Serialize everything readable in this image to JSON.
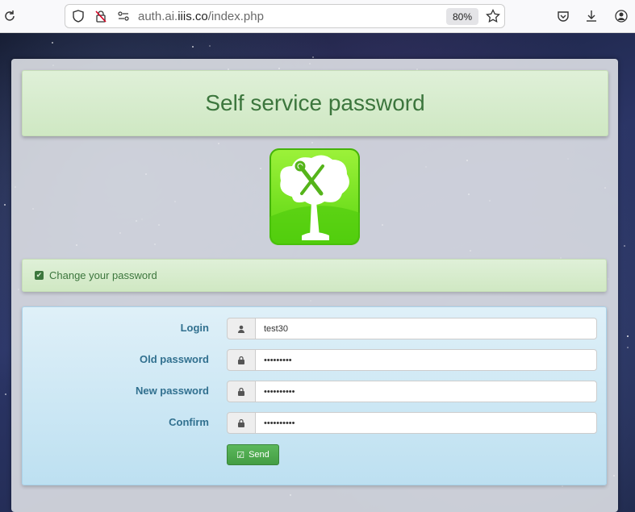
{
  "browser": {
    "url_domain": "auth.ai.",
    "url_highlight": "iiis.co",
    "url_path": "/index.php",
    "zoom": "80%"
  },
  "page": {
    "title": "Self service password",
    "alert_text": "Change your password",
    "form": {
      "fields": [
        {
          "label": "Login",
          "value": "test30",
          "icon": "user-icon"
        },
        {
          "label": "Old password",
          "value": "•••••••••",
          "icon": "lock-icon"
        },
        {
          "label": "New password",
          "value": "••••••••••",
          "icon": "lock-icon"
        },
        {
          "label": "Confirm",
          "value": "••••••••••",
          "icon": "lock-icon"
        }
      ],
      "send_label": "Send"
    }
  },
  "colors": {
    "success_text": "#3c763d",
    "info_text": "#31708f",
    "button_green": "#5cb85c"
  }
}
